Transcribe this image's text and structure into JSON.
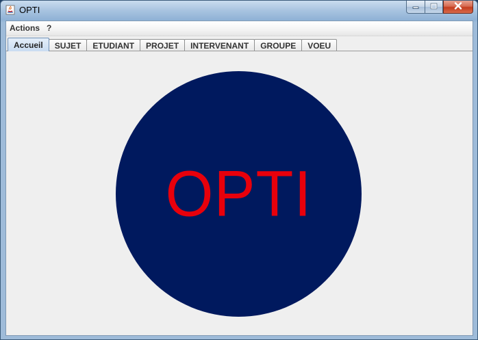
{
  "window": {
    "title": "OPTI"
  },
  "menubar": {
    "items": [
      {
        "label": "Actions"
      },
      {
        "label": "?"
      }
    ]
  },
  "tabs": [
    {
      "label": "Accueil",
      "selected": true
    },
    {
      "label": "SUJET",
      "selected": false
    },
    {
      "label": "ETUDIANT",
      "selected": false
    },
    {
      "label": "PROJET",
      "selected": false
    },
    {
      "label": "INTERVENANT",
      "selected": false
    },
    {
      "label": "GROUPE",
      "selected": false
    },
    {
      "label": "VOEU",
      "selected": false
    }
  ],
  "home": {
    "logo_text": "OPTI"
  },
  "colors": {
    "logo_circle": "#00195e",
    "logo_text": "#e8000b"
  },
  "icons": {
    "app": "java-app-icon",
    "minimize": "minimize-icon",
    "maximize": "maximize-icon",
    "close": "close-icon"
  }
}
